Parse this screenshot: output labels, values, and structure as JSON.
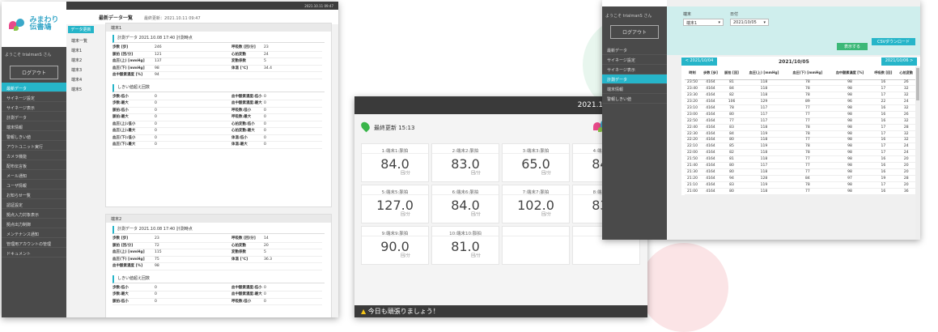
{
  "colors": {
    "accent": "#26b5c9",
    "sidebar": "#4a4a4a",
    "topbar": "#3a3a3a",
    "green": "#3cb878"
  },
  "logo": {
    "line1": "みまわり",
    "line2": "伝書鳩"
  },
  "p1": {
    "topbar_time": "2021.10.11 09:47",
    "page_title": "最新データ一覧",
    "updated": "最終更新：2021.10.11 09:47",
    "welcome": "ようこそ trialmanS さん",
    "logout": "ログアウト",
    "menu": [
      "最新データ",
      "サイネージ設定",
      "サイネージ表示",
      "計測データ",
      "端末情報",
      "警報しきい値",
      "アウトユニット実行",
      "カメラ機能",
      "配布伝言板",
      "メール通知",
      "ユーザ情報",
      "お知らせ一覧",
      "認証設定",
      "拠点入力対象表示",
      "拠点出力制御",
      "メンテナンス通知",
      "管理用アカウントの管理",
      "ドキュメント"
    ],
    "update_btn": "データ更新",
    "terms_header": "端末一覧",
    "terms": [
      "端末1",
      "端末2",
      "端末3",
      "端末4",
      "端末5"
    ],
    "cards": [
      {
        "title": "端末1",
        "meas": "計測データ 2021.10.08 17:40 計測時点",
        "rows": [
          [
            "歩数 [歩]",
            "246",
            "呼吸数 [回/分]",
            "23"
          ],
          [
            "脈拍 [回/分]",
            "121",
            "心拍変動",
            "24"
          ],
          [
            "血圧(上) [mmHg]",
            "137",
            "変動係数",
            "5"
          ],
          [
            "血圧(下) [mmHg]",
            "98",
            "体温 [℃]",
            "34.4"
          ],
          [
            "血中酸素濃度 [%]",
            "94",
            "",
            ""
          ]
        ],
        "thr": "しきい値超え回数",
        "trows": [
          [
            "歩数:低小",
            "0",
            "血中酸素濃度:低小",
            "0"
          ],
          [
            "歩数:最大",
            "0",
            "血中酸素濃度:最大",
            "0"
          ],
          [
            "脈拍:低小",
            "0",
            "呼吸数:低小",
            "0"
          ],
          [
            "脈拍:最大",
            "0",
            "呼吸数:最大",
            "0"
          ],
          [
            "血圧(上):低小",
            "0",
            "心拍変動:低小",
            "0"
          ],
          [
            "血圧(上):最大",
            "0",
            "心拍変動:最大",
            "0"
          ],
          [
            "血圧(下):低小",
            "0",
            "体温:低小",
            "0"
          ],
          [
            "血圧(下):最大",
            "0",
            "体温:最大",
            "0"
          ]
        ]
      },
      {
        "title": "端末2",
        "meas": "計測データ 2021.10.08 17:40 計測時点",
        "rows": [
          [
            "歩数 [歩]",
            "23",
            "呼吸数 [回/分]",
            "14"
          ],
          [
            "脈拍 [回/分]",
            "72",
            "心拍変動",
            "20"
          ],
          [
            "血圧(上) [mmHg]",
            "115",
            "変動係数",
            "5"
          ],
          [
            "血圧(下) [mmHg]",
            "75",
            "体温 [℃]",
            "36.3"
          ],
          [
            "血中酸素濃度 [%]",
            "98",
            "",
            ""
          ]
        ],
        "thr": "しきい値超え回数",
        "trows": [
          [
            "歩数:低小",
            "0",
            "血中酸素濃度:低小",
            "0"
          ],
          [
            "歩数:最大",
            "0",
            "血中酸素濃度:最大",
            "0"
          ],
          [
            "脈拍:低小",
            "0",
            "呼吸数:低小",
            "0"
          ]
        ]
      }
    ]
  },
  "p2": {
    "time": "2021.10.07 11:00",
    "updated": "最終更新 15:13",
    "tiles": [
      {
        "label": "1:端末1:脈拍",
        "value": "84.0",
        "unit": "回/分"
      },
      {
        "label": "2:端末2:脈拍",
        "value": "83.0",
        "unit": "回/分"
      },
      {
        "label": "3:端末3:脈拍",
        "value": "65.0",
        "unit": "回/分"
      },
      {
        "label": "4:端末4:脈拍",
        "value": "84.0",
        "unit": "回/分"
      },
      {
        "label": "5:端末5:脈拍",
        "value": "127.0",
        "unit": "回/分"
      },
      {
        "label": "6:端末6:脈拍",
        "value": "84.0",
        "unit": "回/分"
      },
      {
        "label": "7:端末7:脈拍",
        "value": "102.0",
        "unit": "回/分"
      },
      {
        "label": "8:端末8:脈拍",
        "value": "83.0",
        "unit": "回/分"
      },
      {
        "label": "9:端末9:脈拍",
        "value": "90.0",
        "unit": "回/分"
      },
      {
        "label": "10:端末10:脈拍",
        "value": "81.0",
        "unit": "回/分"
      },
      {
        "label": "",
        "value": "",
        "unit": ""
      },
      {
        "label": "",
        "value": "",
        "unit": ""
      },
      {
        "label": "",
        "value": "",
        "unit": ""
      },
      {
        "label": "",
        "value": "",
        "unit": ""
      },
      {
        "label": "",
        "value": "",
        "unit": ""
      },
      {
        "label": "",
        "value": "",
        "unit": ""
      }
    ],
    "footer": "今日も頑張りましょう！"
  },
  "p3": {
    "welcome": "ようこそ trialmanS さん",
    "logout": "ログアウト",
    "menu": [
      "最新データ",
      "サイネージ設定",
      "サイネージ表示",
      "計測データ",
      "端末情報",
      "警報しきい値"
    ],
    "term_label": "端末",
    "term_value": "端末1",
    "date_label": "日付",
    "date_value": "2021/10/05",
    "show_btn": "表示する",
    "csv_btn": "CSVダウンロード",
    "prev": "< 2021/10/04",
    "date": "2021/10/05",
    "next": "2021/10/06 >",
    "headers": [
      "時刻",
      "歩数 [歩]",
      "脈拍 [回]",
      "血圧(上) [mmHg]",
      "血圧(下) [mmHg]",
      "血中酸素濃度 [%]",
      "呼吸数 [回]",
      "心拍変動"
    ],
    "rows": [
      [
        "23:50",
        "4164",
        "81",
        "118",
        "78",
        "98",
        "16",
        "26"
      ],
      [
        "23:40",
        "4164",
        "84",
        "118",
        "78",
        "98",
        "17",
        "32"
      ],
      [
        "23:30",
        "4164",
        "82",
        "118",
        "78",
        "98",
        "17",
        "32"
      ],
      [
        "23:20",
        "4164",
        "106",
        "129",
        "89",
        "96",
        "22",
        "24"
      ],
      [
        "23:10",
        "4164",
        "78",
        "117",
        "77",
        "98",
        "16",
        "32"
      ],
      [
        "23:00",
        "4164",
        "80",
        "117",
        "77",
        "98",
        "16",
        "26"
      ],
      [
        "22:50",
        "4164",
        "77",
        "117",
        "77",
        "98",
        "16",
        "32"
      ],
      [
        "22:40",
        "4164",
        "83",
        "118",
        "78",
        "98",
        "17",
        "28"
      ],
      [
        "22:30",
        "4164",
        "84",
        "119",
        "78",
        "98",
        "17",
        "32"
      ],
      [
        "22:20",
        "4164",
        "80",
        "118",
        "77",
        "98",
        "16",
        "32"
      ],
      [
        "22:10",
        "4164",
        "85",
        "119",
        "78",
        "98",
        "17",
        "24"
      ],
      [
        "22:00",
        "4164",
        "82",
        "118",
        "78",
        "98",
        "17",
        "24"
      ],
      [
        "21:50",
        "4164",
        "81",
        "118",
        "77",
        "98",
        "16",
        "20"
      ],
      [
        "21:40",
        "4164",
        "80",
        "117",
        "77",
        "98",
        "16",
        "20"
      ],
      [
        "21:30",
        "4164",
        "80",
        "118",
        "77",
        "98",
        "16",
        "20"
      ],
      [
        "21:20",
        "4164",
        "94",
        "128",
        "84",
        "97",
        "19",
        "28"
      ],
      [
        "21:10",
        "4164",
        "83",
        "119",
        "78",
        "98",
        "17",
        "20"
      ],
      [
        "21:00",
        "4164",
        "80",
        "118",
        "77",
        "98",
        "16",
        "36"
      ]
    ]
  }
}
